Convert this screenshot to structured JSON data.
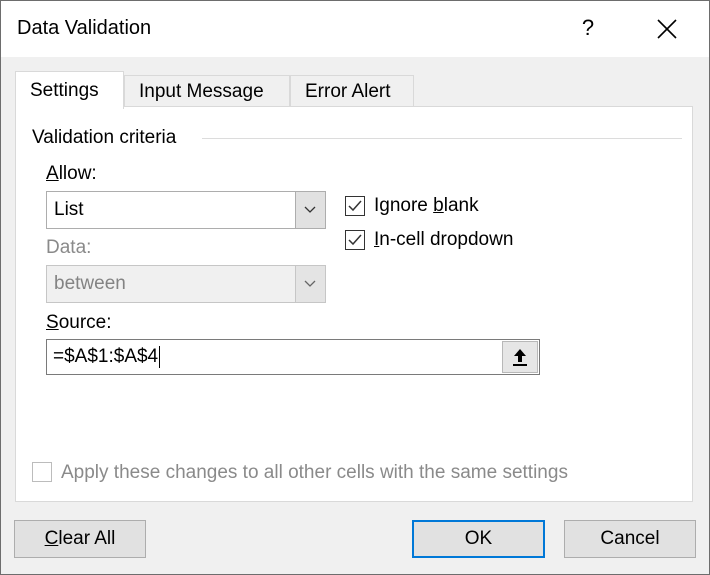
{
  "window": {
    "title": "Data Validation",
    "help_label": "?",
    "close_icon": "close-icon"
  },
  "tabs": [
    {
      "label": "Settings",
      "active": true
    },
    {
      "label": "Input Message",
      "active": false
    },
    {
      "label": "Error Alert",
      "active": false
    }
  ],
  "settings": {
    "group_label": "Validation criteria",
    "allow": {
      "label": "Allow:",
      "accesskey": "A",
      "label_rest": "llow:",
      "value": "List"
    },
    "data": {
      "label": "Data:",
      "value": "between",
      "disabled": true
    },
    "ignore_blank": {
      "label_pre": "Ignore ",
      "accesskey": "b",
      "label_post": "lank",
      "checked": true
    },
    "in_cell_dropdown": {
      "accesskey": "I",
      "label_post": "n-cell dropdown",
      "checked": true
    },
    "source": {
      "accesskey": "S",
      "label_rest": "ource:",
      "value": "=$A$1:$A$4",
      "collapse_icon": "arrow-up-icon"
    },
    "apply_all": {
      "label": "Apply these changes to all other cells with the same settings",
      "checked": false,
      "disabled": true
    }
  },
  "buttons": {
    "clear_all_accesskey": "C",
    "clear_all_rest": "lear All",
    "ok": "OK",
    "cancel": "Cancel"
  },
  "colors": {
    "accent": "#0078d7"
  }
}
